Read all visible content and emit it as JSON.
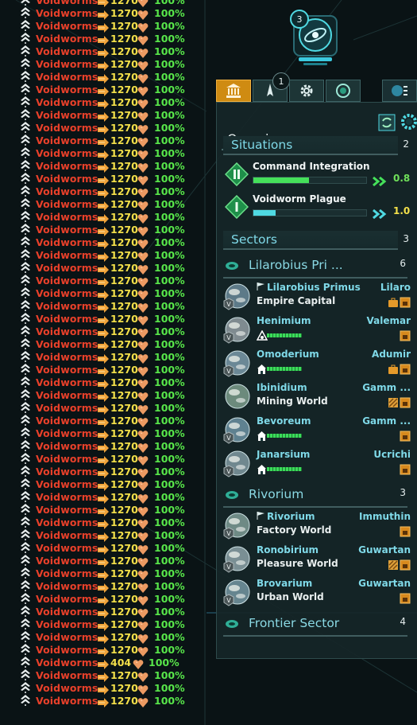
{
  "fleet_list": {
    "rows": [
      {
        "name": "Voidworms",
        "power": "1270",
        "health": "100%"
      },
      {
        "name": "Voidworms",
        "power": "1270",
        "health": "100%"
      },
      {
        "name": "Voidworms",
        "power": "1270",
        "health": "100%"
      },
      {
        "name": "Voidworms",
        "power": "1270",
        "health": "100%"
      },
      {
        "name": "Voidworms",
        "power": "1270",
        "health": "100%"
      },
      {
        "name": "Voidworms",
        "power": "1270",
        "health": "100%"
      },
      {
        "name": "Voidworms",
        "power": "1270",
        "health": "100%"
      },
      {
        "name": "Voidworms",
        "power": "1270",
        "health": "100%"
      },
      {
        "name": "Voidworms",
        "power": "1270",
        "health": "100%"
      },
      {
        "name": "Voidworms",
        "power": "1270",
        "health": "100%"
      },
      {
        "name": "Voidworms",
        "power": "1270",
        "health": "100%"
      },
      {
        "name": "Voidworms",
        "power": "1270",
        "health": "100%"
      },
      {
        "name": "Voidworms",
        "power": "1270",
        "health": "100%"
      },
      {
        "name": "Voidworms",
        "power": "1270",
        "health": "100%"
      },
      {
        "name": "Voidworms",
        "power": "1270",
        "health": "100%"
      },
      {
        "name": "Voidworms",
        "power": "1270",
        "health": "100%"
      },
      {
        "name": "Voidworms",
        "power": "1270",
        "health": "100%"
      },
      {
        "name": "Voidworms",
        "power": "1270",
        "health": "100%"
      },
      {
        "name": "Voidworms",
        "power": "1270",
        "health": "100%"
      },
      {
        "name": "Voidworms",
        "power": "1270",
        "health": "100%"
      },
      {
        "name": "Voidworms",
        "power": "1270",
        "health": "100%"
      },
      {
        "name": "Voidworms",
        "power": "1270",
        "health": "100%"
      },
      {
        "name": "Voidworms",
        "power": "1270",
        "health": "100%"
      },
      {
        "name": "Voidworms",
        "power": "1270",
        "health": "100%"
      },
      {
        "name": "Voidworms",
        "power": "1270",
        "health": "100%"
      },
      {
        "name": "Voidworms",
        "power": "1270",
        "health": "100%"
      },
      {
        "name": "Voidworms",
        "power": "1270",
        "health": "100%"
      },
      {
        "name": "Voidworms",
        "power": "1270",
        "health": "100%"
      },
      {
        "name": "Voidworms",
        "power": "1270",
        "health": "100%"
      },
      {
        "name": "Voidworms",
        "power": "1270",
        "health": "100%"
      },
      {
        "name": "Voidworms",
        "power": "1270",
        "health": "100%"
      },
      {
        "name": "Voidworms",
        "power": "1270",
        "health": "100%"
      },
      {
        "name": "Voidworms",
        "power": "1270",
        "health": "100%"
      },
      {
        "name": "Voidworms",
        "power": "1270",
        "health": "100%"
      },
      {
        "name": "Voidworms",
        "power": "1270",
        "health": "100%"
      },
      {
        "name": "Voidworms",
        "power": "1270",
        "health": "100%"
      },
      {
        "name": "Voidworms",
        "power": "1270",
        "health": "100%"
      },
      {
        "name": "Voidworms",
        "power": "1270",
        "health": "100%"
      },
      {
        "name": "Voidworms",
        "power": "1270",
        "health": "100%"
      },
      {
        "name": "Voidworms",
        "power": "1270",
        "health": "100%"
      },
      {
        "name": "Voidworms",
        "power": "1270",
        "health": "100%"
      },
      {
        "name": "Voidworms",
        "power": "1270",
        "health": "100%"
      },
      {
        "name": "Voidworms",
        "power": "1270",
        "health": "100%"
      },
      {
        "name": "Voidworms",
        "power": "1270",
        "health": "100%"
      },
      {
        "name": "Voidworms",
        "power": "1270",
        "health": "100%"
      },
      {
        "name": "Voidworms",
        "power": "1270",
        "health": "100%"
      },
      {
        "name": "Voidworms",
        "power": "1270",
        "health": "100%"
      },
      {
        "name": "Voidworms",
        "power": "1270",
        "health": "100%"
      },
      {
        "name": "Voidworms",
        "power": "1270",
        "health": "100%"
      },
      {
        "name": "Voidworms",
        "power": "1270",
        "health": "100%"
      },
      {
        "name": "Voidworms",
        "power": "1270",
        "health": "100%"
      },
      {
        "name": "Voidworms",
        "power": "1270",
        "health": "100%"
      },
      {
        "name": "Voidworms",
        "power": "404",
        "health": "100%"
      },
      {
        "name": "Voidworms",
        "power": "1270",
        "health": "100%"
      },
      {
        "name": "Voidworms",
        "power": "1270",
        "health": "100%"
      },
      {
        "name": "Voidworms",
        "power": "1270",
        "health": "100%"
      }
    ]
  },
  "emblem": {
    "count": "3"
  },
  "outliner": {
    "tabs": [
      {
        "icon": "government-building-icon"
      },
      {
        "icon": "ship-icon",
        "badge": "1"
      },
      {
        "icon": "gear-icon"
      },
      {
        "icon": "species-icon"
      }
    ],
    "title": "Overview",
    "situations": {
      "label": "Situations",
      "count": "2",
      "items": [
        {
          "name": "Command Integration",
          "progress": 0.49,
          "value": "0.8",
          "color": "#45e05a",
          "value_color": "#6fe05a"
        },
        {
          "name": "Voidworm Plague",
          "progress": 0.2,
          "value": "1.0",
          "color": "#4fd9e2",
          "value_color": "#f3e04a"
        }
      ]
    },
    "sectors_label": "Sectors",
    "sectors_count": "3",
    "sectors": [
      {
        "name": "Lilarobius Pri ...",
        "count": "6",
        "planets": [
          {
            "name": "Lilarobius Primus",
            "capital": true,
            "type": "Empire Capital",
            "owner": "Lilaro",
            "jobs": [
              "briefcase",
              "factory"
            ]
          },
          {
            "name": "Henimium",
            "type": "",
            "owner": "Valemar",
            "jobs": [
              "factory"
            ],
            "colonizing": true
          },
          {
            "name": "Omoderium",
            "type": "",
            "owner": "Adumir",
            "jobs": [
              "briefcase",
              "factory"
            ],
            "growing": true
          },
          {
            "name": "Ibinidium",
            "type": "Mining World",
            "owner": "Gamm ...",
            "jobs": [
              "mining",
              "factory"
            ]
          },
          {
            "name": "Bevoreum",
            "type": "",
            "owner": "Gamm ...",
            "jobs": [
              "factory"
            ],
            "growing": true
          },
          {
            "name": "Janarsium",
            "type": "",
            "owner": "Ucrichi",
            "jobs": [
              "factory"
            ],
            "growing": true
          }
        ]
      },
      {
        "name": "Rivorium",
        "count": "3",
        "planets": [
          {
            "name": "Rivorium",
            "capital": true,
            "type": "Factory World",
            "owner": "Immuthin",
            "jobs": [
              "factory"
            ]
          },
          {
            "name": "Ronobirium",
            "type": "Pleasure World",
            "owner": "Guwartan",
            "jobs": [
              "mining",
              "factory"
            ]
          },
          {
            "name": "Brovarium",
            "type": "Urban World",
            "owner": "Guwartan",
            "jobs": [
              "factory"
            ]
          }
        ]
      },
      {
        "name": "Frontier Sector",
        "count": "4",
        "planets": []
      }
    ]
  },
  "colors": {
    "fleet_name": "#e8402a",
    "power": "#f3e04a",
    "health": "#58e64a",
    "accent": "#7fd9e8",
    "tab_active": "#cf8b12"
  }
}
